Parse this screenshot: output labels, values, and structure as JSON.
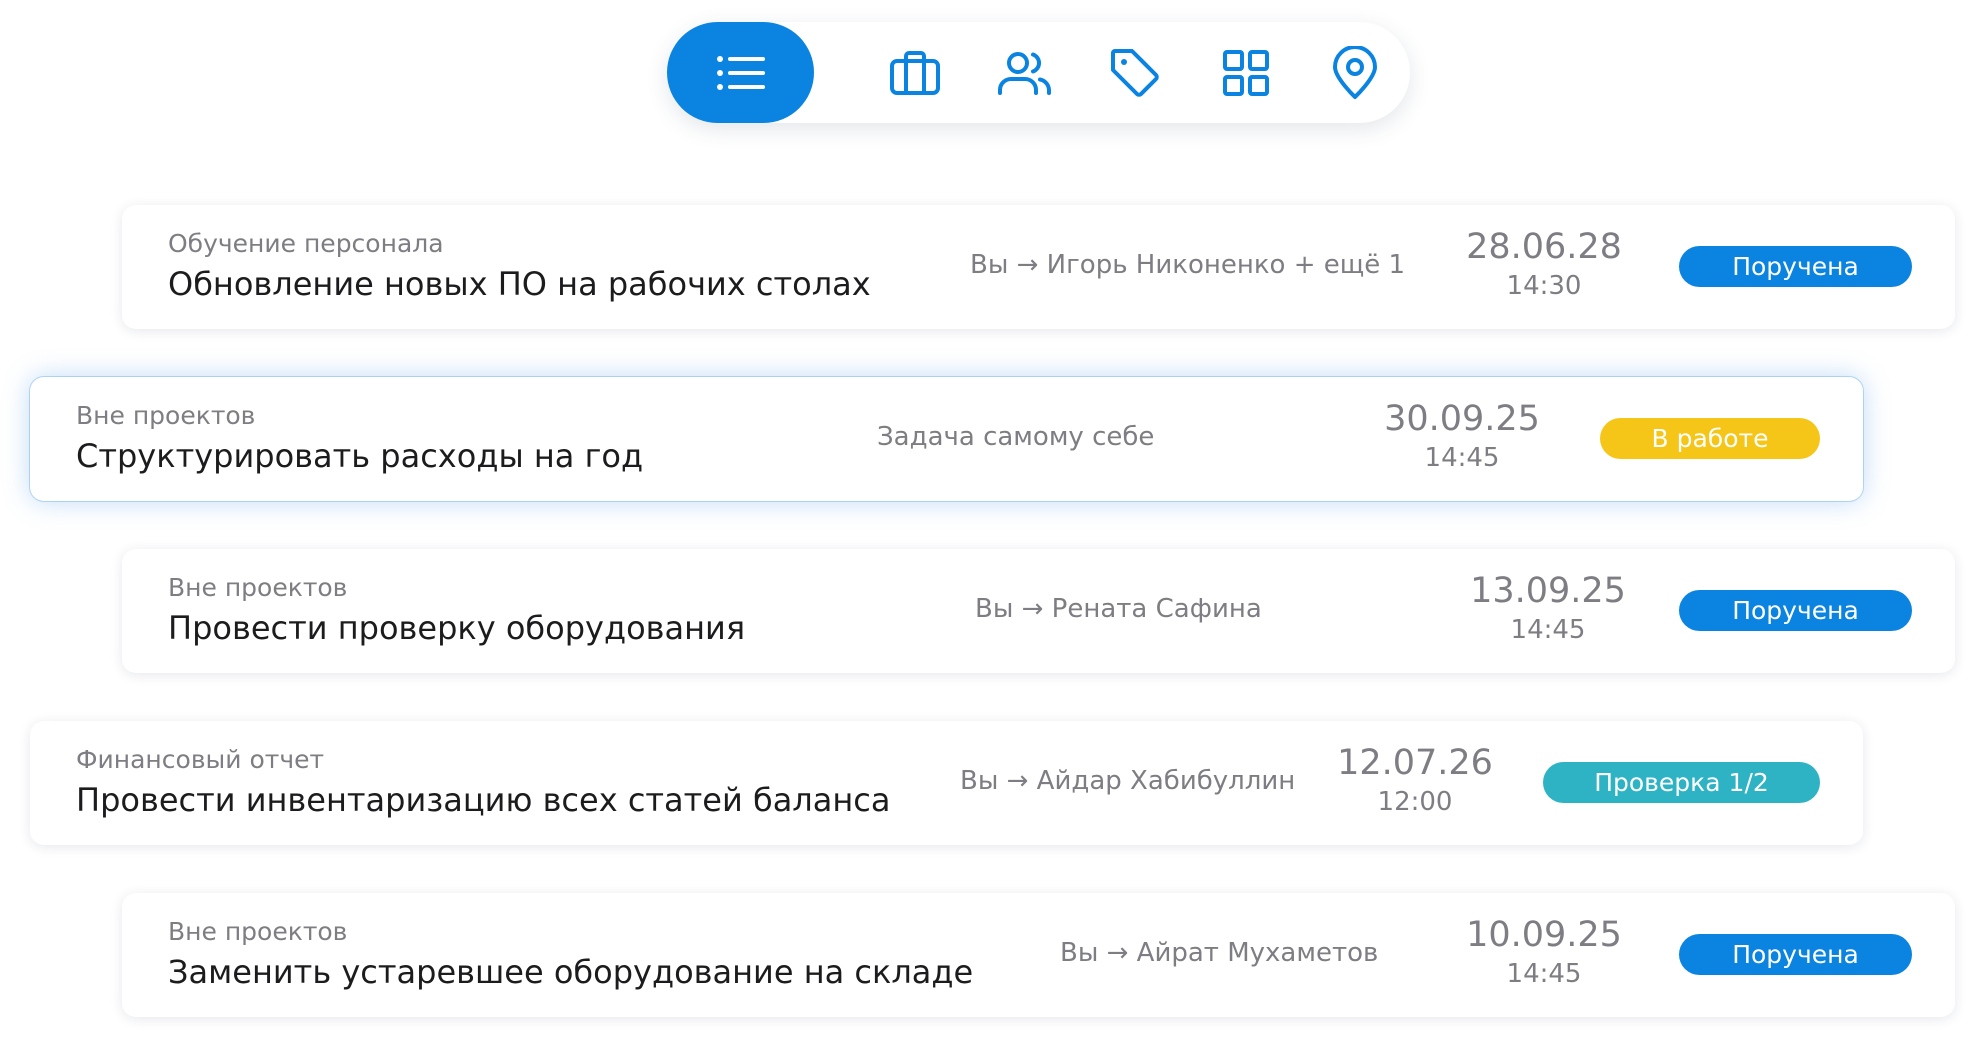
{
  "nav": {
    "items": [
      {
        "icon": "list-icon",
        "active": true
      },
      {
        "icon": "briefcase-icon",
        "active": false
      },
      {
        "icon": "users-icon",
        "active": false
      },
      {
        "icon": "tag-icon",
        "active": false
      },
      {
        "icon": "grid-icon",
        "active": false
      },
      {
        "icon": "location-pin-icon",
        "active": false
      }
    ],
    "active_color": "#0a84e0",
    "icon_color": "#0a84e0"
  },
  "tasks": [
    {
      "project": "Обучение персонала",
      "title": "Обновление новых ПО на рабочих столах",
      "assignment": "Вы → Игорь Никоненко + ещё 1",
      "date": "28.06.28",
      "time": "14:30",
      "status": "Поручена",
      "status_color": "#0a84e0",
      "highlighted": false
    },
    {
      "project": "Вне проектов",
      "title": "Структурировать расходы на год",
      "assignment": "Задача самому себе",
      "date": "30.09.25",
      "time": "14:45",
      "status": "В работе",
      "status_color": "#f5c518",
      "highlighted": true
    },
    {
      "project": "Вне проектов",
      "title": "Провести проверку оборудования",
      "assignment": "Вы → Рената Сафина",
      "date": "13.09.25",
      "time": "14:45",
      "status": "Поручена",
      "status_color": "#0a84e0",
      "highlighted": false
    },
    {
      "project": "Финансовый отчет",
      "title": "Провести инвентаризацию всех статей баланса",
      "assignment": "Вы → Айдар Хабибуллин",
      "date": "12.07.26",
      "time": "12:00",
      "status": "Проверка 1/2",
      "status_color": "#2eb3c4",
      "highlighted": false
    },
    {
      "project": "Вне проектов",
      "title": "Заменить устаревшее оборудование на складе",
      "assignment": "Вы → Айрат Мухаметов",
      "date": "10.09.25",
      "time": "14:45",
      "status": "Поручена",
      "status_color": "#0a84e0",
      "highlighted": false
    }
  ]
}
